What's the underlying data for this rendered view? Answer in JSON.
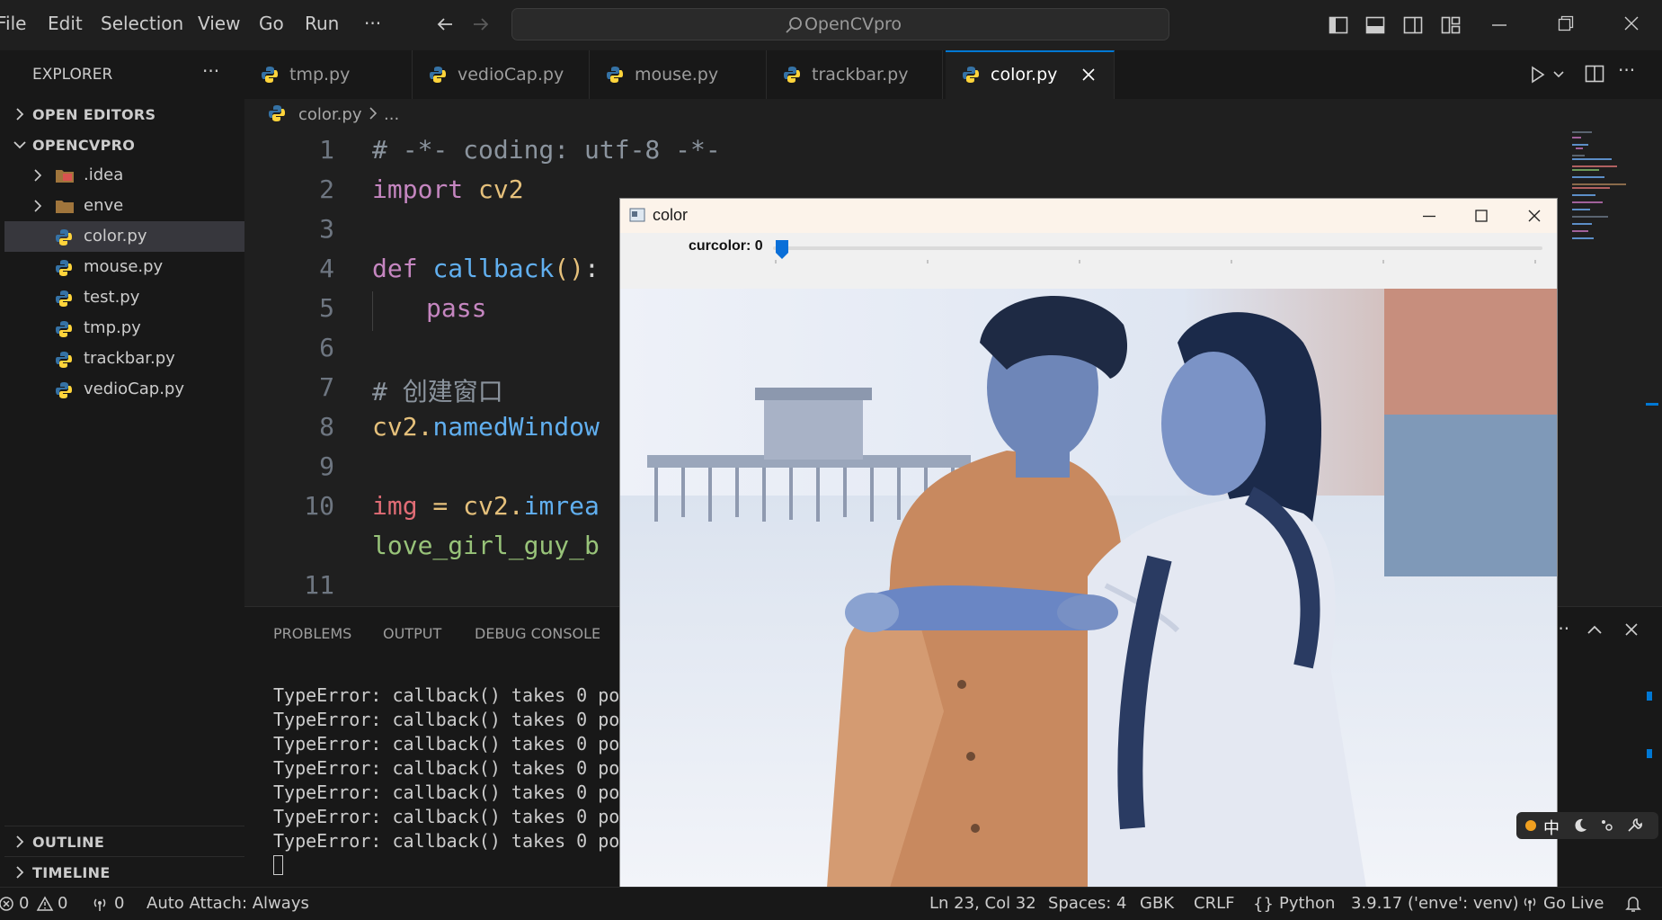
{
  "titlebar": {
    "menu": [
      "File",
      "Edit",
      "Selection",
      "View",
      "Go",
      "Run",
      "···"
    ],
    "search_text": "OpenCVpro"
  },
  "sidebar": {
    "title": "EXPLORER",
    "more": "···",
    "open_editors": "OPEN EDITORS",
    "project": "OPENCVPRO",
    "items": [
      {
        "label": ".idea",
        "type": "folder"
      },
      {
        "label": "enve",
        "type": "folder"
      },
      {
        "label": "color.py",
        "type": "python"
      },
      {
        "label": "mouse.py",
        "type": "python"
      },
      {
        "label": "test.py",
        "type": "python"
      },
      {
        "label": "tmp.py",
        "type": "python"
      },
      {
        "label": "trackbar.py",
        "type": "python"
      },
      {
        "label": "vedioCap.py",
        "type": "python"
      }
    ],
    "outline": "OUTLINE",
    "timeline": "TIMELINE"
  },
  "tabs": [
    "tmp.py",
    "vedioCap.py",
    "mouse.py",
    "trackbar.py",
    "color.py"
  ],
  "active_tab": "color.py",
  "breadcrumb": {
    "file": "color.py",
    "rest": "..."
  },
  "editor": {
    "line_numbers": [
      "1",
      "2",
      "3",
      "4",
      "5",
      "6",
      "7",
      "8",
      "9",
      "10",
      "11"
    ],
    "line1": "# -*- coding: utf-8 -*-",
    "line2_kw": "import",
    "line2_mod": " cv2",
    "line4_kw": "def",
    "line4_fn": "callback",
    "line4_paren": "()",
    "line4_colon": ":",
    "line5_kw": "pass",
    "line7": "# 创建窗口",
    "line8_mod": "cv2.",
    "line8_fn": "namedWindow",
    "line10_var": "img",
    "line10_eq": " = ",
    "line10_mod": "cv2.",
    "line10_fn": "imrea",
    "line10b": "love_girl_guy_b"
  },
  "panel": {
    "tabs": [
      "PROBLEMS",
      "OUTPUT",
      "DEBUG CONSOLE"
    ],
    "more": "···",
    "terminal_lines": [
      "TypeError: callback() takes 0 po",
      "TypeError: callback() takes 0 po",
      "TypeError: callback() takes 0 po",
      "TypeError: callback() takes 0 po",
      "TypeError: callback() takes 0 po",
      "TypeError: callback() takes 0 po",
      "TypeError: callback() takes 0 po"
    ]
  },
  "statusbar": {
    "errors": "0",
    "warnings": "0",
    "ports": "0",
    "auto_attach": "Auto Attach: Always",
    "position": "Ln 23, Col 32",
    "spaces": "Spaces: 4",
    "encoding": "GBK",
    "eol": "CRLF",
    "language": "Python",
    "interpreter": "3.9.17 ('enve': venv)",
    "golive": "Go Live"
  },
  "cv_window": {
    "title": "color",
    "trackbar_label": "curcolor: 0",
    "trackbar_value": 0
  },
  "ime": {
    "mode": "中"
  },
  "colors": {
    "accent": "#0078d4",
    "python_blue": "#3572a5",
    "python_yellow": "#ffd43b"
  }
}
